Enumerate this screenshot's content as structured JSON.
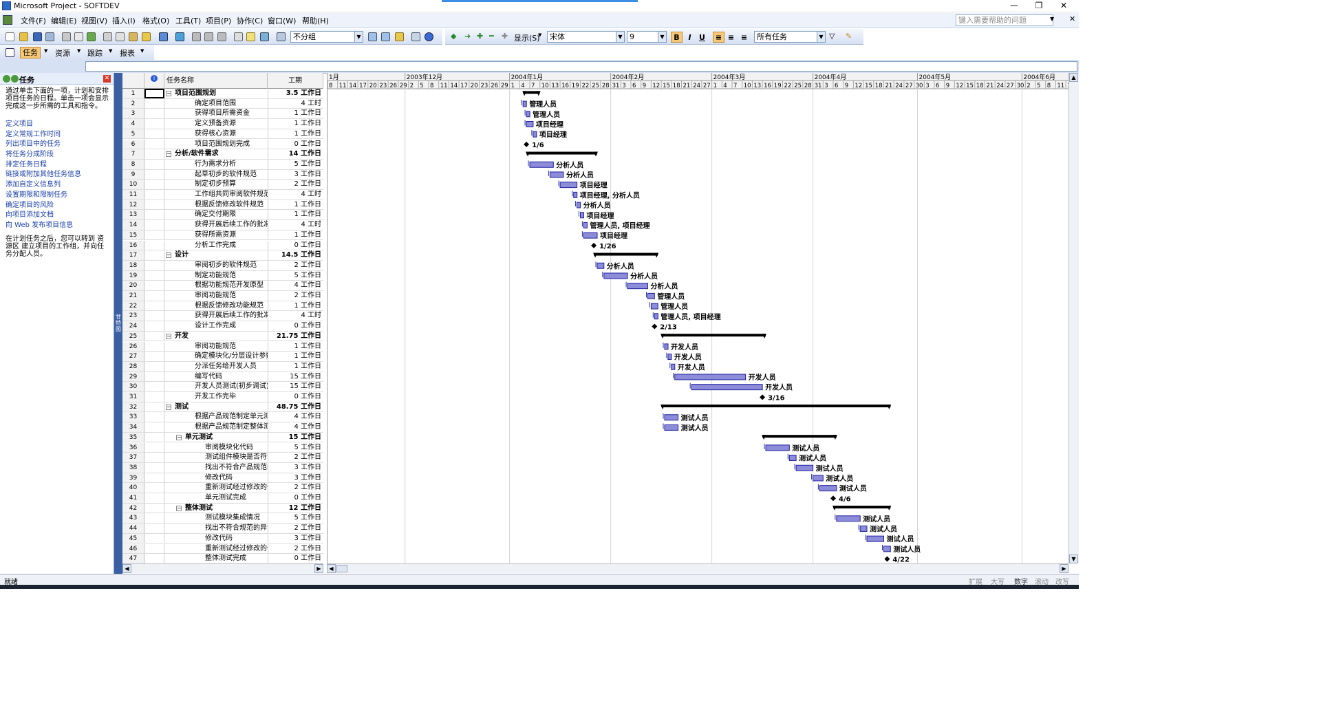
{
  "window": {
    "title": "Microsoft Project - SOFTDEV",
    "controls": [
      "—",
      "❐",
      "✕"
    ]
  },
  "menu": [
    "文件(F)",
    "编辑(E)",
    "视图(V)",
    "插入(I)",
    "格式(O)",
    "工具(T)",
    "项目(P)",
    "协作(C)",
    "窗口(W)",
    "帮助(H)"
  ],
  "help_placeholder": "键入需要帮助的问题",
  "toolbar": {
    "group_select": "不分组",
    "show_label": "显示(S)",
    "font": "宋体",
    "font_size": "9",
    "bold": "B",
    "italic": "I",
    "underline": "U",
    "filter": "所有任务"
  },
  "guide": {
    "tasks": "任务",
    "resources": "资源",
    "tracking": "跟踪",
    "report": "报表"
  },
  "taskpane": {
    "title": "任务",
    "intro": "通过单击下面的一项，计划和安排项目任务的日程。单击一项会显示完成这一步所需的工具和指令。",
    "links": [
      "定义项目",
      "定义常规工作时间",
      "列出项目中的任务",
      "将任务分成阶段",
      "排定任务日程",
      "链接或附加其他任务信息",
      "添加自定义信息列",
      "设置期限和限制任务",
      "确定项目的风险",
      "向项目添加文档",
      "向 Web 发布项目信息"
    ],
    "outro": "在计划任务之后，您可以转到 资源区 建立项目的工作组，并向任务分配人员。"
  },
  "sidebar_label": "甘特图",
  "grid": {
    "head_info": "i",
    "head_name": "任务名称",
    "head_dur": "工期",
    "tasks": [
      {
        "id": "1",
        "level": 0,
        "summary": true,
        "name": "项目范围规划",
        "dur": "3.5 工作日"
      },
      {
        "id": "2",
        "level": 1,
        "summary": false,
        "name": "确定项目范围",
        "dur": "4 工时"
      },
      {
        "id": "3",
        "level": 1,
        "summary": false,
        "name": "获得项目所需资金",
        "dur": "1 工作日"
      },
      {
        "id": "4",
        "level": 1,
        "summary": false,
        "name": "定义预备资源",
        "dur": "1 工作日"
      },
      {
        "id": "5",
        "level": 1,
        "summary": false,
        "name": "获得核心资源",
        "dur": "1 工作日"
      },
      {
        "id": "6",
        "level": 1,
        "summary": false,
        "name": "项目范围规划完成",
        "dur": "0 工作日"
      },
      {
        "id": "7",
        "level": 0,
        "summary": true,
        "name": "分析/软件需求",
        "dur": "14 工作日"
      },
      {
        "id": "8",
        "level": 1,
        "summary": false,
        "name": "行为需求分析",
        "dur": "5 工作日"
      },
      {
        "id": "9",
        "level": 1,
        "summary": false,
        "name": "起草初步的软件规范",
        "dur": "3 工作日"
      },
      {
        "id": "10",
        "level": 1,
        "summary": false,
        "name": "制定初步预算",
        "dur": "2 工作日"
      },
      {
        "id": "11",
        "level": 1,
        "summary": false,
        "name": "工作组共同审阅软件规范/预算",
        "dur": "4 工时"
      },
      {
        "id": "12",
        "level": 1,
        "summary": false,
        "name": "根据反馈修改软件规范",
        "dur": "1 工作日"
      },
      {
        "id": "13",
        "level": 1,
        "summary": false,
        "name": "确定交付期限",
        "dur": "1 工作日"
      },
      {
        "id": "14",
        "level": 1,
        "summary": false,
        "name": "获得开展后续工作的批准(概念",
        "dur": "4 工时"
      },
      {
        "id": "15",
        "level": 1,
        "summary": false,
        "name": "获得所需资源",
        "dur": "1 工作日"
      },
      {
        "id": "16",
        "level": 1,
        "summary": false,
        "name": "分析工作完成",
        "dur": "0 工作日"
      },
      {
        "id": "17",
        "level": 0,
        "summary": true,
        "name": "设计",
        "dur": "14.5 工作日"
      },
      {
        "id": "18",
        "level": 1,
        "summary": false,
        "name": "审阅初步的软件规范",
        "dur": "2 工作日"
      },
      {
        "id": "19",
        "level": 1,
        "summary": false,
        "name": "制定功能规范",
        "dur": "5 工作日"
      },
      {
        "id": "20",
        "level": 1,
        "summary": false,
        "name": "根据功能规范开发原型",
        "dur": "4 工作日"
      },
      {
        "id": "21",
        "level": 1,
        "summary": false,
        "name": "审阅功能规范",
        "dur": "2 工作日"
      },
      {
        "id": "22",
        "level": 1,
        "summary": false,
        "name": "根据反馈修改功能规范",
        "dur": "1 工作日"
      },
      {
        "id": "23",
        "level": 1,
        "summary": false,
        "name": "获得开展后续工作的批准",
        "dur": "4 工时"
      },
      {
        "id": "24",
        "level": 1,
        "summary": false,
        "name": "设计工作完成",
        "dur": "0 工作日"
      },
      {
        "id": "25",
        "level": 0,
        "summary": true,
        "name": "开发",
        "dur": "21.75 工作日"
      },
      {
        "id": "26",
        "level": 1,
        "summary": false,
        "name": "审阅功能规范",
        "dur": "1 工作日"
      },
      {
        "id": "27",
        "level": 1,
        "summary": false,
        "name": "确定模块化/分层设计参数",
        "dur": "1 工作日"
      },
      {
        "id": "28",
        "level": 1,
        "summary": false,
        "name": "分派任务给开发人员",
        "dur": "1 工作日"
      },
      {
        "id": "29",
        "level": 1,
        "summary": false,
        "name": "编写代码",
        "dur": "15 工作日"
      },
      {
        "id": "30",
        "level": 1,
        "summary": false,
        "name": "开发人员测试(初步调试)",
        "dur": "15 工作日"
      },
      {
        "id": "31",
        "level": 1,
        "summary": false,
        "name": "开发工作完毕",
        "dur": "0 工作日"
      },
      {
        "id": "32",
        "level": 0,
        "summary": true,
        "name": "测试",
        "dur": "48.75 工作日"
      },
      {
        "id": "33",
        "level": 1,
        "summary": false,
        "name": "根据产品规范制定单元测试计划",
        "dur": "4 工作日"
      },
      {
        "id": "34",
        "level": 1,
        "summary": false,
        "name": "根据产品规范制定整体测试计划",
        "dur": "4 工作日"
      },
      {
        "id": "35",
        "level": 1,
        "summary": true,
        "name": "单元测试",
        "dur": "15 工作日"
      },
      {
        "id": "36",
        "level": 2,
        "summary": false,
        "name": "审阅模块化代码",
        "dur": "5 工作日"
      },
      {
        "id": "37",
        "level": 2,
        "summary": false,
        "name": "测试组件模块是否符合产品规范",
        "dur": "2 工作日"
      },
      {
        "id": "38",
        "level": 2,
        "summary": false,
        "name": "找出不符合产品规范的异常情况",
        "dur": "3 工作日"
      },
      {
        "id": "39",
        "level": 2,
        "summary": false,
        "name": "修改代码",
        "dur": "3 工作日"
      },
      {
        "id": "40",
        "level": 2,
        "summary": false,
        "name": "重新测试经过修改的代码",
        "dur": "2 工作日"
      },
      {
        "id": "41",
        "level": 2,
        "summary": false,
        "name": "单元测试完成",
        "dur": "0 工作日"
      },
      {
        "id": "42",
        "level": 1,
        "summary": true,
        "name": "整体测试",
        "dur": "12 工作日"
      },
      {
        "id": "43",
        "level": 2,
        "summary": false,
        "name": "测试模块集成情况",
        "dur": "5 工作日"
      },
      {
        "id": "44",
        "level": 2,
        "summary": false,
        "name": "找出不符合规范的异常情况",
        "dur": "2 工作日"
      },
      {
        "id": "45",
        "level": 2,
        "summary": false,
        "name": "修改代码",
        "dur": "3 工作日"
      },
      {
        "id": "46",
        "level": 2,
        "summary": false,
        "name": "重新测试经过修改的代码",
        "dur": "2 工作日"
      },
      {
        "id": "47",
        "level": 2,
        "summary": false,
        "name": "整体测试完成",
        "dur": "0 工作日"
      }
    ]
  },
  "timescale": {
    "months": [
      "1月",
      "2003年12月",
      "2004年1月",
      "2004年2月",
      "2004年3月",
      "2004年4月",
      "2004年5月",
      "2004年6月"
    ],
    "days": [
      "8",
      "11",
      "14",
      "17",
      "20",
      "23",
      "26",
      "29",
      "2",
      "5",
      "8",
      "11",
      "14",
      "17",
      "20",
      "23",
      "26",
      "29",
      "1",
      "4",
      "7",
      "10",
      "13",
      "16",
      "19",
      "22",
      "25",
      "28",
      "31",
      "3",
      "6",
      "9",
      "12",
      "15",
      "18",
      "21",
      "24",
      "27",
      "1",
      "4",
      "7",
      "10",
      "13",
      "16",
      "19",
      "22",
      "25",
      "28",
      "31",
      "3",
      "6",
      "9",
      "12",
      "15",
      "18",
      "21",
      "24",
      "27",
      "30",
      "3",
      "6",
      "9",
      "12",
      "15",
      "18",
      "21",
      "24",
      "27",
      "30",
      "2",
      "5",
      "8",
      "11",
      "1"
    ]
  },
  "gantt_bars": [
    {
      "row": 1,
      "type": "summary",
      "start": "2004-01-05",
      "end": "2004-01-09"
    },
    {
      "row": 2,
      "type": "task",
      "start": "2004-01-05",
      "end": "2004-01-05",
      "label": "管理人员"
    },
    {
      "row": 3,
      "type": "task",
      "start": "2004-01-06",
      "end": "2004-01-06",
      "label": "管理人员"
    },
    {
      "row": 4,
      "type": "task",
      "start": "2004-01-06",
      "end": "2004-01-07",
      "label": "项目经理"
    },
    {
      "row": 5,
      "type": "task",
      "start": "2004-01-08",
      "end": "2004-01-08",
      "label": "项目经理"
    },
    {
      "row": 6,
      "type": "milestone",
      "start": "2004-01-06",
      "end": "2004-01-06",
      "label": "1/6"
    },
    {
      "row": 7,
      "type": "summary",
      "start": "2004-01-06",
      "end": "2004-01-26"
    },
    {
      "row": 8,
      "type": "task",
      "start": "2004-01-07",
      "end": "2004-01-13",
      "label": "分析人员"
    },
    {
      "row": 9,
      "type": "task",
      "start": "2004-01-13",
      "end": "2004-01-16",
      "label": "分析人员"
    },
    {
      "row": 10,
      "type": "task",
      "start": "2004-01-16",
      "end": "2004-01-20",
      "label": "项目经理"
    },
    {
      "row": 11,
      "type": "task",
      "start": "2004-01-20",
      "end": "2004-01-20",
      "label": "项目经理, 分析人员"
    },
    {
      "row": 12,
      "type": "task",
      "start": "2004-01-21",
      "end": "2004-01-21",
      "label": "分析人员"
    },
    {
      "row": 13,
      "type": "task",
      "start": "2004-01-22",
      "end": "2004-01-22",
      "label": "项目经理"
    },
    {
      "row": 14,
      "type": "task",
      "start": "2004-01-23",
      "end": "2004-01-23",
      "label": "管理人员, 项目经理"
    },
    {
      "row": 15,
      "type": "task",
      "start": "2004-01-23",
      "end": "2004-01-26",
      "label": "项目经理"
    },
    {
      "row": 16,
      "type": "milestone",
      "start": "2004-01-26",
      "end": "2004-01-26",
      "label": "1/26"
    },
    {
      "row": 17,
      "type": "summary",
      "start": "2004-01-26",
      "end": "2004-02-13"
    },
    {
      "row": 18,
      "type": "task",
      "start": "2004-01-27",
      "end": "2004-01-28",
      "label": "分析人员"
    },
    {
      "row": 19,
      "type": "task",
      "start": "2004-01-29",
      "end": "2004-02-04",
      "label": "分析人员"
    },
    {
      "row": 20,
      "type": "task",
      "start": "2004-02-05",
      "end": "2004-02-10",
      "label": "分析人员"
    },
    {
      "row": 21,
      "type": "task",
      "start": "2004-02-11",
      "end": "2004-02-12",
      "label": "管理人员"
    },
    {
      "row": 22,
      "type": "task",
      "start": "2004-02-12",
      "end": "2004-02-13",
      "label": "管理人员"
    },
    {
      "row": 23,
      "type": "task",
      "start": "2004-02-13",
      "end": "2004-02-13",
      "label": "管理人员, 项目经理"
    },
    {
      "row": 24,
      "type": "milestone",
      "start": "2004-02-13",
      "end": "2004-02-13",
      "label": "2/13"
    },
    {
      "row": 25,
      "type": "summary",
      "start": "2004-02-15",
      "end": "2004-03-16"
    },
    {
      "row": 26,
      "type": "task",
      "start": "2004-02-16",
      "end": "2004-02-16",
      "label": "开发人员"
    },
    {
      "row": 27,
      "type": "task",
      "start": "2004-02-17",
      "end": "2004-02-17",
      "label": "开发人员"
    },
    {
      "row": 28,
      "type": "task",
      "start": "2004-02-18",
      "end": "2004-02-18",
      "label": "开发人员"
    },
    {
      "row": 29,
      "type": "task",
      "start": "2004-02-19",
      "end": "2004-03-10",
      "label": "开发人员"
    },
    {
      "row": 30,
      "type": "task",
      "start": "2004-02-24",
      "end": "2004-03-15",
      "label": "开发人员"
    },
    {
      "row": 31,
      "type": "milestone",
      "start": "2004-03-16",
      "end": "2004-03-16",
      "label": "3/16"
    },
    {
      "row": 32,
      "type": "summary",
      "start": "2004-02-15",
      "end": "2004-04-22"
    },
    {
      "row": 33,
      "type": "task",
      "start": "2004-02-16",
      "end": "2004-02-19",
      "label": "测试人员"
    },
    {
      "row": 34,
      "type": "task",
      "start": "2004-02-16",
      "end": "2004-02-19",
      "label": "测试人员"
    },
    {
      "row": 35,
      "type": "summary",
      "start": "2004-03-16",
      "end": "2004-04-06"
    },
    {
      "row": 36,
      "type": "task",
      "start": "2004-03-17",
      "end": "2004-03-23",
      "label": "测试人员"
    },
    {
      "row": 37,
      "type": "task",
      "start": "2004-03-24",
      "end": "2004-03-25",
      "label": "测试人员"
    },
    {
      "row": 38,
      "type": "task",
      "start": "2004-03-26",
      "end": "2004-03-30",
      "label": "测试人员"
    },
    {
      "row": 39,
      "type": "task",
      "start": "2004-03-31",
      "end": "2004-04-02",
      "label": "测试人员"
    },
    {
      "row": 40,
      "type": "task",
      "start": "2004-04-02",
      "end": "2004-04-06",
      "label": "测试人员"
    },
    {
      "row": 41,
      "type": "milestone",
      "start": "2004-04-06",
      "end": "2004-04-06",
      "label": "4/6"
    },
    {
      "row": 42,
      "type": "summary",
      "start": "2004-04-06",
      "end": "2004-04-22"
    },
    {
      "row": 43,
      "type": "task",
      "start": "2004-04-07",
      "end": "2004-04-13",
      "label": "测试人员"
    },
    {
      "row": 44,
      "type": "task",
      "start": "2004-04-14",
      "end": "2004-04-15",
      "label": "测试人员"
    },
    {
      "row": 45,
      "type": "task",
      "start": "2004-04-16",
      "end": "2004-04-20",
      "label": "测试人员"
    },
    {
      "row": 46,
      "type": "task",
      "start": "2004-04-21",
      "end": "2004-04-22",
      "label": "测试人员"
    },
    {
      "row": 47,
      "type": "milestone",
      "start": "2004-04-22",
      "end": "2004-04-22",
      "label": "4/22"
    }
  ],
  "status": {
    "left": "就绪",
    "ext": "扩展",
    "caps": "大写",
    "num": "数字",
    "scrl": "滚动",
    "ovr": "改写"
  },
  "colors": {
    "bar_fill": "#8c8cd8",
    "bar_border": "#2020a0",
    "summary": "#000000",
    "link": "#1f2fb0",
    "accent": "#3a5fa3"
  }
}
